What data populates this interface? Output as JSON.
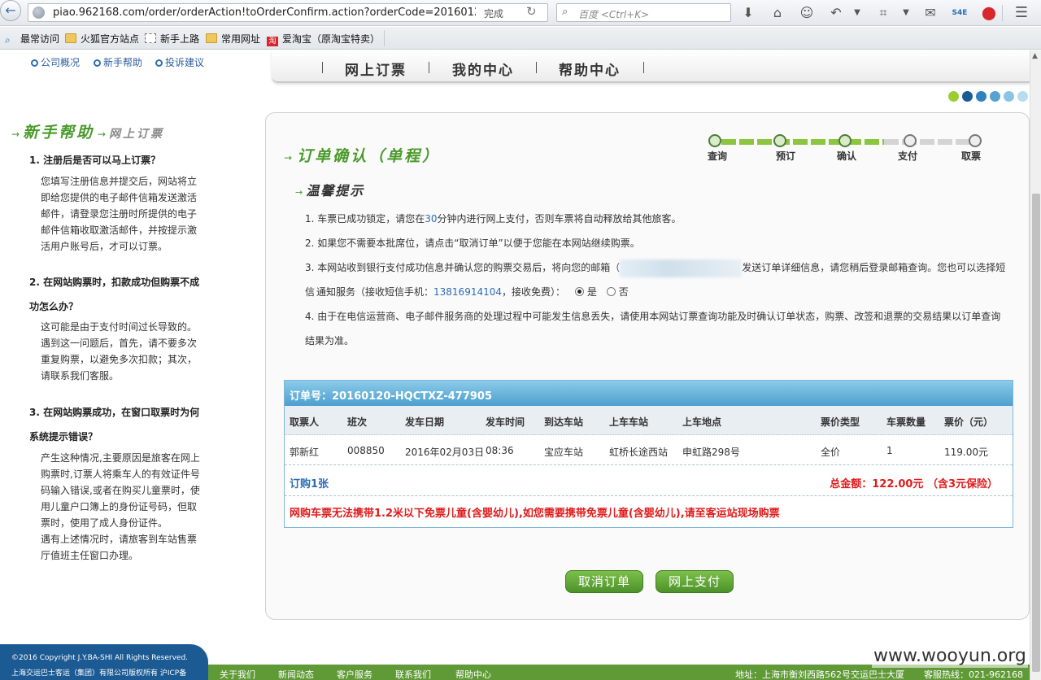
{
  "browser": {
    "url": "piao.962168.com/order/orderAction!toOrderConfirm.action?orderCode=20160120-HQ...",
    "status": "完成",
    "search_placeholder": "百度 <Ctrl+K>",
    "bookmarks": [
      "最常访问",
      "火狐官方站点",
      "新手上路",
      "常用网址",
      "爱淘宝（原淘宝特卖）"
    ],
    "icons": [
      "back-icon",
      "globe-icon",
      "reload-icon",
      "search-icon",
      "download-icon",
      "home-icon",
      "chat-icon",
      "undo-icon",
      "crop-icon",
      "comment-icon",
      "s4e-icon",
      "adblock-icon",
      "menu-icon"
    ]
  },
  "toplinks": [
    "公司概况",
    "新手帮助",
    "投诉建议"
  ],
  "nav": [
    "网上订票",
    "我的中心",
    "帮助中心"
  ],
  "colors": {
    "accent_green": "#4a9a2b",
    "link_blue": "#2d6db5",
    "alert_red": "#e01b1b",
    "footer_blue": "#1b5a93"
  },
  "help": {
    "title": "新手帮助",
    "subtitle": "网上订票",
    "items": [
      {
        "q": "1. 注册后是否可以马上订票？",
        "a": "您填写注册信息并提交后，网站将立即给您提供的电子邮件信箱发送激活邮件，请登录您注册时所提供的电子邮件信箱收取激活邮件，并按提示激活用户账号后，才可以订票。"
      },
      {
        "q": "2. 在网站购票时，扣款成功但购票不成功怎么办？",
        "a": "这可能是由于支付时间过长导致的。遇到这一问题后，首先，请不要多次重复购票，以避免多次扣款；其次，请联系我们客服。"
      },
      {
        "q": "3. 在网站购票成功，在窗口取票时为何系统提示错误？",
        "a": "产生这种情况,主要原因是旅客在网上购票时,订票人将乘车人的有效证件号码输入错误,或者在购买儿童票时，使用儿童户口簿上的身份证号码，但取票时，使用了成人身份证件。",
        "a2": "遇有上述情况时，请旅客到车站售票厅值班主任窗口办理。"
      }
    ]
  },
  "order": {
    "title": "订单确认（单程）",
    "tips_title": "温馨提示",
    "steps": [
      "查询",
      "预订",
      "确认",
      "支付",
      "取票"
    ],
    "current_step": 3,
    "tips": {
      "t1_a": "1. 车票已成功锁定，请您在",
      "t1_min": "30",
      "t1_b": "分钟内进行网上支付，否则车票将自动释放给其他旅客。",
      "t2": "2. 如果您不需要本批席位，请点击“取消订单”以便于您能在本网站继续购票。",
      "t3_a": "3. 本网站收到银行支付成功信息并确认您的购票交易后，将向您的邮箱（",
      "t3_b": "发送订单详细信息，请您稍后登录邮箱查询。您也可以选择短信",
      "t3_c": "通知服务（接收短信手机：",
      "phone": "13816914104",
      "t3_d": "，接收免费）：",
      "yes": "是",
      "no": "否",
      "t4": "4. 由于在电信运营商、电子邮件服务商的处理过程中可能发生信息丢失，请使用本网站订票查询功能及时确认订单状态，购票、改签和退票的交易结果以订单查询结果为准。"
    },
    "order_no_label": "订单号：20160120-HQCTXZ-477905",
    "columns": [
      "取票人",
      "班次",
      "发车日期",
      "发车时间",
      "到达车站",
      "上车车站",
      "上车地点",
      "票价类型",
      "车票数量",
      "票价（元）"
    ],
    "row": [
      "郭新红",
      "008850",
      "2016年02月03日",
      "08:36",
      "宝应车站",
      "虹桥长途西站",
      "申虹路298号",
      "全价",
      "1",
      "119.00元"
    ],
    "count": "订购1张",
    "total": "总金额：122.00元 （含3元保险）",
    "warning": "网购车票无法携带1.2米以下免票儿童(含婴幼儿),如您需要携带免票儿童(含婴幼儿),请至客运站现场购票",
    "cancel_label": "取消订单",
    "pay_label": "网上支付"
  },
  "footer": {
    "copyright": "©2016 Copyright J.Y.BA-SHI All Rights Reserved.",
    "company": "上海交运巴士客运（集团）有限公司版权所有 沪ICP备",
    "links": [
      "关于我们",
      "新闻动态",
      "客户服务",
      "联系我们",
      "帮助中心"
    ],
    "address": "地址：上海市衡刘西路562号交运巴士大厦",
    "hotline": "客服热线：021-962168",
    "watermark": "www.wooyun.org"
  }
}
